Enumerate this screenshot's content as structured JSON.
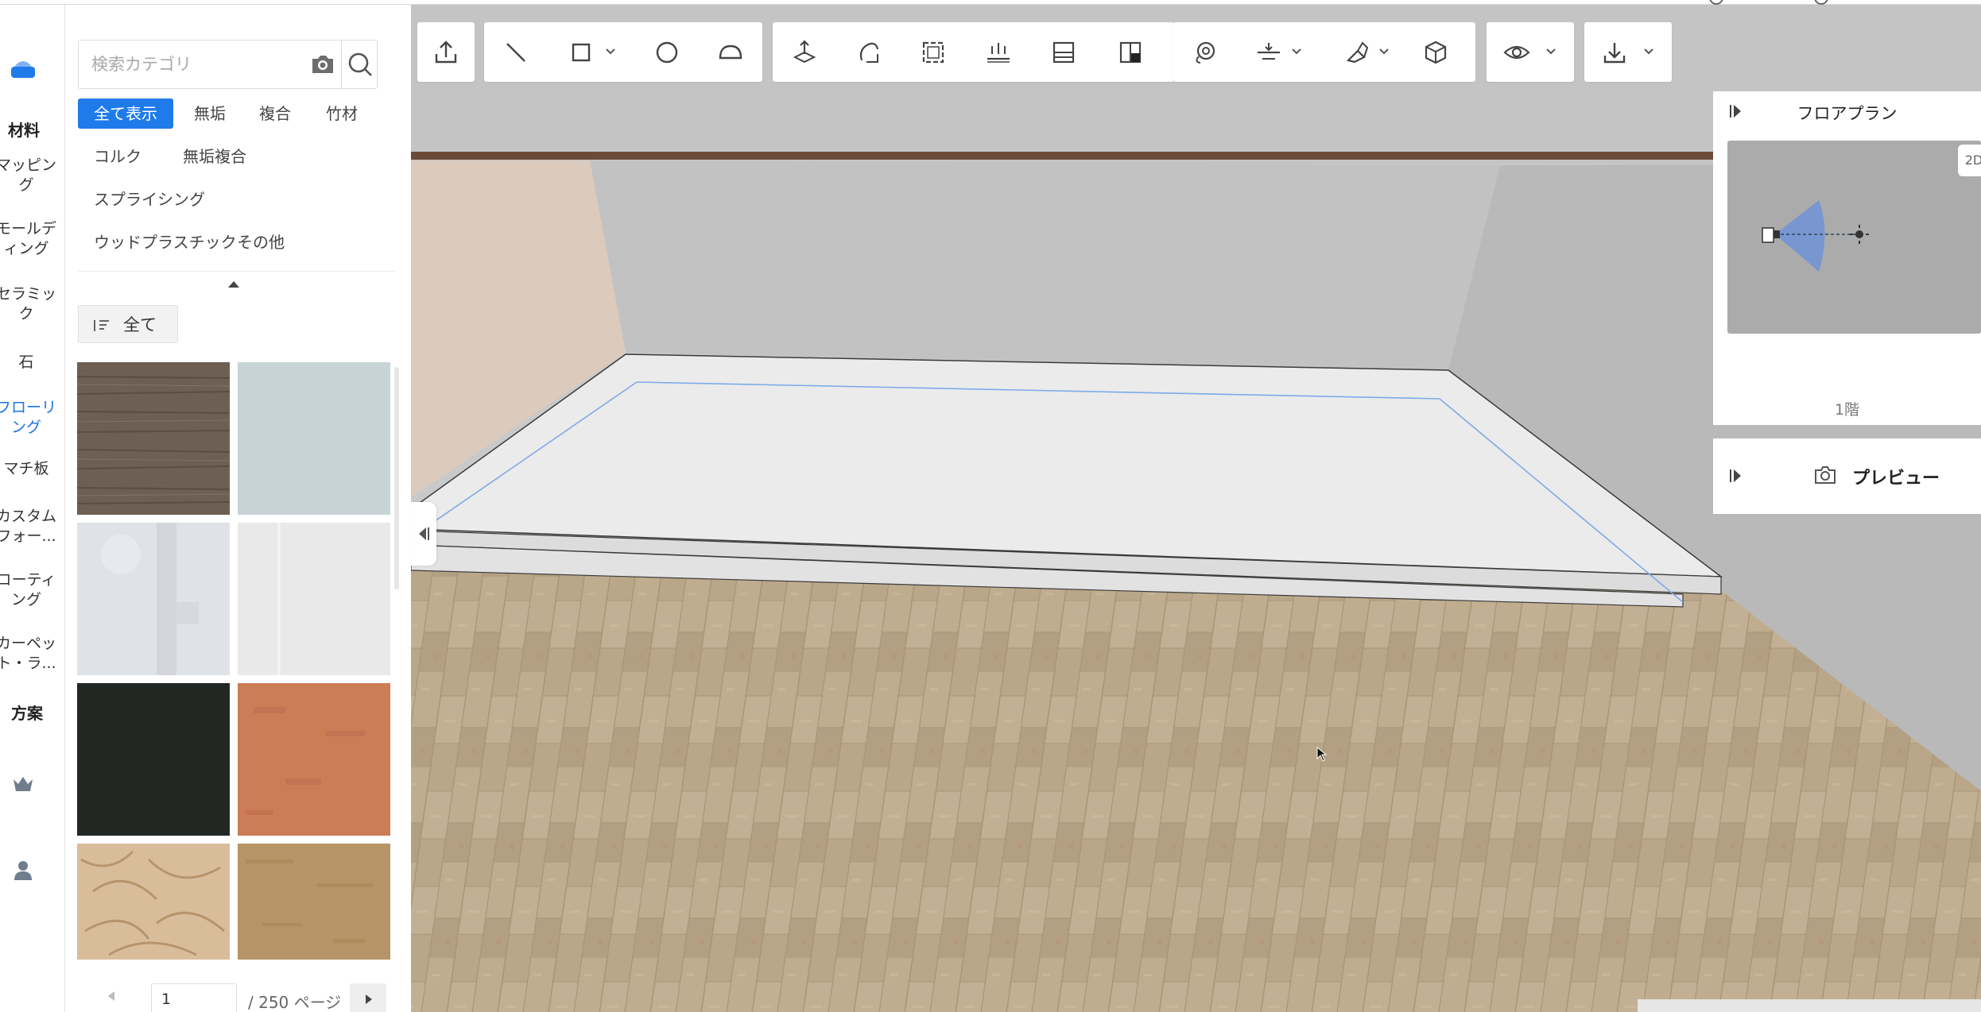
{
  "rail": {
    "section_materials": "材料",
    "items": [
      {
        "label": "マッピン\nグ"
      },
      {
        "label": "モールデ\nィング"
      },
      {
        "label": "セラミッ\nク"
      },
      {
        "label": "石"
      },
      {
        "label": "フローリ\nング",
        "active": true
      },
      {
        "label": "マチ板"
      },
      {
        "label": "カスタム\nフォー..."
      },
      {
        "label": "コーティ\nング"
      },
      {
        "label": "カーペッ\nト・ラ..."
      }
    ],
    "section_plans": "方案",
    "icons": [
      "home-icon",
      "crown-icon",
      "user-icon"
    ]
  },
  "panel": {
    "search_placeholder": "検索カテゴリ",
    "chips": [
      "全て表示",
      "無垢",
      "複合",
      "竹材",
      "コルク",
      "無垢複合",
      "スプライシング",
      "ウッドプラスチック",
      "その他"
    ],
    "active_chip": "全て表示",
    "sort_label": "全て",
    "tiles": [
      {
        "name": "dark-walnut"
      },
      {
        "name": "pale-blue-grey"
      },
      {
        "name": "light-grey-panel"
      },
      {
        "name": "white-panel"
      },
      {
        "name": "black"
      },
      {
        "name": "terracotta"
      },
      {
        "name": "woven-rattan"
      },
      {
        "name": "tan-wood"
      }
    ],
    "pager": {
      "current": "1",
      "total_label": "/ 250 ページ"
    }
  },
  "toolbar": {
    "groups": [
      [
        "upload-icon"
      ],
      [
        "line-tool-icon",
        "rectangle-tool-icon",
        "circle-tool-icon",
        "arc-tool-icon"
      ],
      [
        "push-pull-icon",
        "rotate-icon",
        "region-icon",
        "floor-heating-icon",
        "wall-panel-icon",
        "layout-icon"
      ],
      [
        "lasso-icon",
        "align-icon",
        "paint-brush-icon",
        "3d-box-icon"
      ],
      [
        "view-eye-icon"
      ],
      [
        "download-icon"
      ]
    ]
  },
  "floorplan": {
    "title": "フロアプラン",
    "mode": "2D",
    "floor_label": "1階"
  },
  "preview": {
    "label": "プレビュー"
  },
  "colors": {
    "accent": "#1f7bea",
    "floor": "#b9a588",
    "platform": "#ebebeb"
  }
}
